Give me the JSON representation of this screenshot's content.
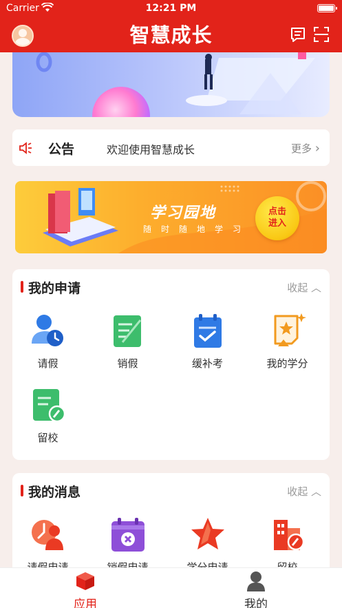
{
  "status_bar": {
    "carrier": "Carrier",
    "time": "12:21 PM"
  },
  "header": {
    "title": "智慧成长"
  },
  "notice": {
    "label": "公告",
    "text": "欢迎使用智慧成长",
    "more": "更多"
  },
  "study_banner": {
    "title": "学习园地",
    "subtitle": "随时随地学习",
    "button_line1": "点击",
    "button_line2": "进入"
  },
  "applications": {
    "title": "我的申请",
    "collapse_label": "收起",
    "items": [
      {
        "label": "请假",
        "icon": "leave-icon"
      },
      {
        "label": "销假",
        "icon": "cancel-leave-icon"
      },
      {
        "label": "缓补考",
        "icon": "makeup-exam-icon"
      },
      {
        "label": "我的学分",
        "icon": "credits-icon"
      },
      {
        "label": "留校",
        "icon": "stay-at-school-icon"
      }
    ]
  },
  "messages": {
    "title": "我的消息",
    "collapse_label": "收起",
    "items": [
      {
        "label": "请假申请",
        "icon": "leave-request-icon"
      },
      {
        "label": "销假申请",
        "icon": "cancel-leave-request-icon"
      },
      {
        "label": "学分申请",
        "icon": "credit-request-icon"
      },
      {
        "label": "留校",
        "icon": "stay-request-icon"
      }
    ]
  },
  "tabbar": {
    "tabs": [
      {
        "label": "应用",
        "icon": "cube-icon",
        "active": true
      },
      {
        "label": "我的",
        "icon": "person-icon",
        "active": false
      }
    ]
  },
  "colors": {
    "primary": "#e2231a",
    "background": "#f7eeeb",
    "blue_icon": "#2f7ae5",
    "green_icon": "#3dbd6c",
    "orange_icon": "#f29a1f",
    "purple_icon": "#8e4fd8"
  }
}
